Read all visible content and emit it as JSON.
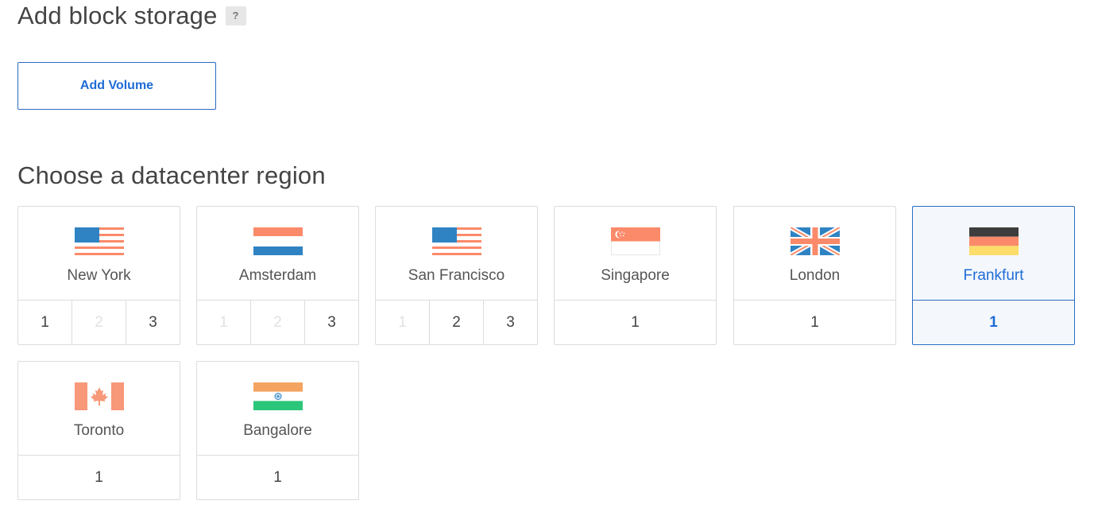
{
  "storage": {
    "title": "Add block storage",
    "help": "?",
    "add_volume_label": "Add Volume"
  },
  "region": {
    "title": "Choose a datacenter region",
    "regions": [
      {
        "name": "New York",
        "flag": "us-flag-icon",
        "numbers": [
          {
            "label": "1",
            "disabled": false
          },
          {
            "label": "2",
            "disabled": true
          },
          {
            "label": "3",
            "disabled": false
          }
        ]
      },
      {
        "name": "Amsterdam",
        "flag": "nl-flag-icon",
        "numbers": [
          {
            "label": "1",
            "disabled": true
          },
          {
            "label": "2",
            "disabled": true
          },
          {
            "label": "3",
            "disabled": false
          }
        ]
      },
      {
        "name": "San Francisco",
        "flag": "us-flag-icon",
        "numbers": [
          {
            "label": "1",
            "disabled": true
          },
          {
            "label": "2",
            "disabled": false
          },
          {
            "label": "3",
            "disabled": false
          }
        ]
      },
      {
        "name": "Singapore",
        "flag": "sg-flag-icon",
        "numbers": [
          {
            "label": "1",
            "disabled": false
          }
        ]
      },
      {
        "name": "London",
        "flag": "uk-flag-icon",
        "numbers": [
          {
            "label": "1",
            "disabled": false
          }
        ]
      },
      {
        "name": "Frankfurt",
        "flag": "de-flag-icon",
        "selected": true,
        "numbers": [
          {
            "label": "1",
            "disabled": false
          }
        ]
      },
      {
        "name": "Toronto",
        "flag": "ca-flag-icon",
        "numbers": [
          {
            "label": "1",
            "disabled": false
          }
        ]
      },
      {
        "name": "Bangalore",
        "flag": "in-flag-icon",
        "numbers": [
          {
            "label": "1",
            "disabled": false
          }
        ]
      }
    ]
  },
  "colors": {
    "accent": "#1f6bd6",
    "selected_bg": "#f4f8fd",
    "border": "#dcdcdc",
    "flag_blue": "#2f83c3",
    "flag_coral": "#fb8a6a",
    "flag_dark": "#3d3d3d",
    "flag_yellow": "#fcdd6a",
    "flag_orange": "#f4a460",
    "flag_green": "#2bc67a",
    "flag_salmon": "#f79879"
  }
}
